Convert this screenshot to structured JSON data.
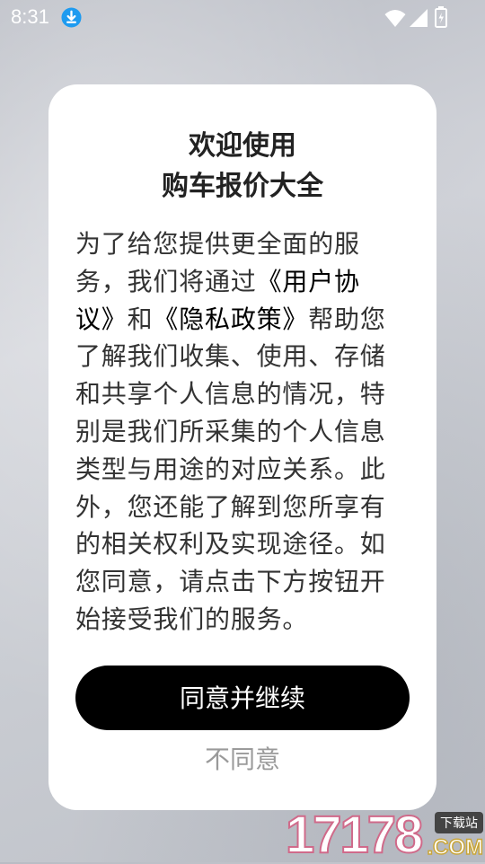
{
  "status_bar": {
    "time": "8:31",
    "icons": [
      "download-icon",
      "wifi-icon",
      "signal-icon",
      "battery-icon"
    ]
  },
  "dialog": {
    "title_line1": "欢迎使用",
    "title_line2": "购车报价大全",
    "body_parts": {
      "p1": "为了给您提供更全面的服务，我们将通过",
      "link1": "《用户协议》",
      "p2": "和",
      "link2": "《隐私政策》",
      "p3": "帮助您了解我们收集、使用、存储和共享个人信息的情况，特别是我们所采集的个人信息类型与用途的对应关系。此外，您还能了解到您所享有的相关权利及实现途径。如您同意，请点击下方按钮开始接受我们的服务。"
    },
    "agree_label": "同意并继续",
    "disagree_label": "不同意"
  },
  "watermark": {
    "number": "17178",
    "tag": "下载站",
    "domain": ".COM"
  },
  "colors": {
    "dialog_bg": "#ffffff",
    "button_bg": "#000000",
    "button_text": "#ffffff",
    "disagree_text": "#9a9a9a",
    "download_badge": "#1e9bf0"
  }
}
